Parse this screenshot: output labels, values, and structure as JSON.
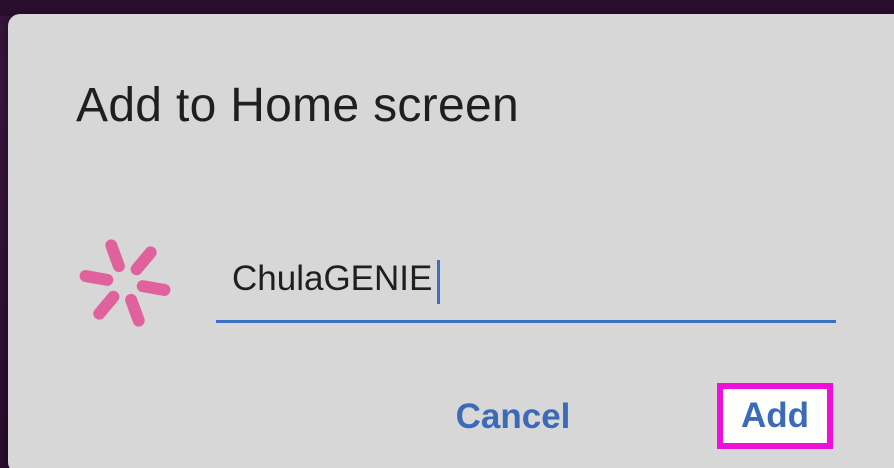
{
  "dialog": {
    "title": "Add to Home screen",
    "app_icon": "pinwheel-icon",
    "name_input": {
      "value": "ChulaGENIE",
      "placeholder": ""
    },
    "buttons": {
      "cancel_label": "Cancel",
      "add_label": "Add"
    }
  },
  "colors": {
    "dialog_background": "#d7d7d7",
    "accent": "#3a6ab8",
    "icon": "#e0629c",
    "highlight_border": "#ee10d8",
    "backdrop": "#2a0e2e"
  }
}
